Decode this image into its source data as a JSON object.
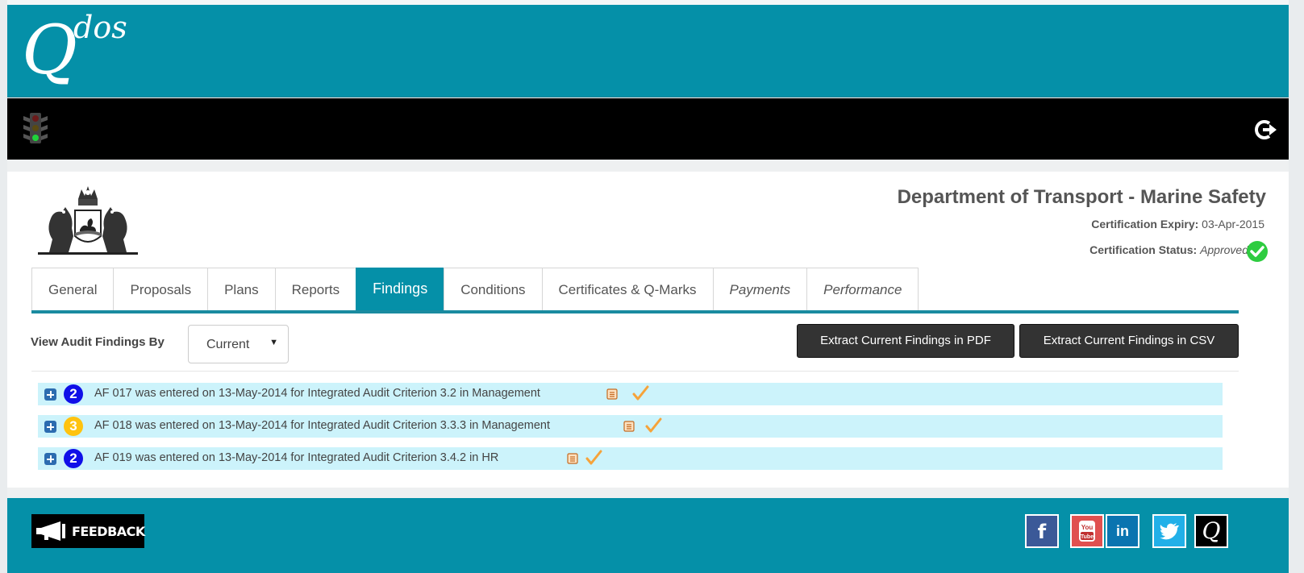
{
  "brand": {
    "logo_main": "Q",
    "logo_sup": "dos"
  },
  "toolbar": {
    "status_icon": "traffic-light-icon",
    "logout_icon": "logout-icon"
  },
  "org": {
    "title": "Department of Transport - Marine Safety",
    "cert_expiry_label": "Certification Expiry:",
    "cert_expiry_value": "03-Apr-2015",
    "cert_status_label": "Certification Status:",
    "cert_status_value": "Approved"
  },
  "tabs": [
    {
      "label": "General",
      "active": false
    },
    {
      "label": "Proposals",
      "active": false
    },
    {
      "label": "Plans",
      "active": false
    },
    {
      "label": "Reports",
      "active": false
    },
    {
      "label": "Findings",
      "active": true
    },
    {
      "label": "Conditions",
      "active": false
    },
    {
      "label": "Certificates & Q-Marks",
      "active": false
    },
    {
      "label": "Payments",
      "active": false
    },
    {
      "label": "Performance",
      "active": false
    }
  ],
  "filter": {
    "label": "View Audit Findings By",
    "selected": "Current"
  },
  "actions": {
    "pdf_label": "Extract Current Findings in PDF",
    "csv_label": "Extract Current Findings in CSV"
  },
  "findings": [
    {
      "badge": "2",
      "text": "AF 017 was entered on 13-May-2014 for Integrated Audit Criterion 3.2 in Management"
    },
    {
      "badge": "3",
      "text": "AF 018 was entered on 13-May-2014 for Integrated Audit Criterion 3.3.3 in Management"
    },
    {
      "badge": "2",
      "text": "AF 019 was entered on 13-May-2014 for Integrated Audit Criterion 3.4.2 in HR"
    }
  ],
  "footer": {
    "feedback_label": "FEEDBACK",
    "social": [
      "facebook-icon",
      "youtube-icon",
      "linkedin-icon",
      "twitter-icon",
      "qdos-icon"
    ],
    "yt_top": "You",
    "yt_bottom": "Tube",
    "fb_glyph": "f",
    "in_glyph": "in",
    "q_glyph": "Q"
  },
  "colors": {
    "teal": "#0590a8",
    "badge_blue": "#1010e8",
    "badge_yellow": "#ffc30f",
    "row_bg": "#ccf3fb",
    "tick": "#f6a33a",
    "approved": "#2ecc40"
  }
}
